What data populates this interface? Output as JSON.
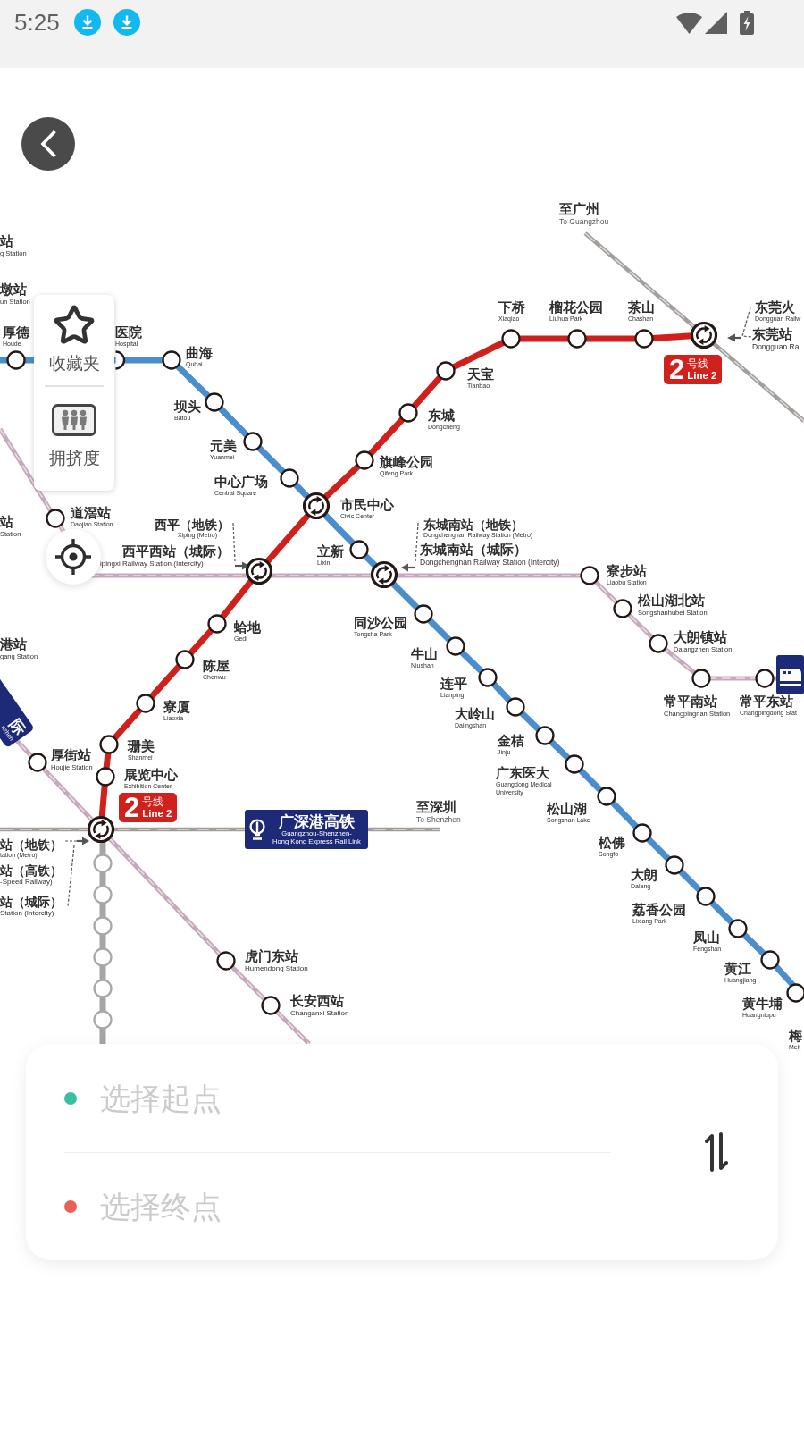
{
  "status_bar": {
    "time": "5:25"
  },
  "map": {
    "lines": [
      {
        "kind": "metro",
        "color": "#d0201b"
      },
      {
        "kind": "metro",
        "color": "#4a8ecd"
      },
      {
        "kind": "intercity",
        "color": "#c6a8bc"
      },
      {
        "kind": "intercity",
        "color": "#c6a8bc"
      },
      {
        "kind": "railway",
        "color": "#a29e9c"
      },
      {
        "kind": "railway",
        "color": "#a29e9c"
      },
      {
        "kind": "metro",
        "color": "#a5a5a5"
      }
    ],
    "stations": [
      {
        "kind": "interchange"
      },
      {
        "kind": "stop"
      },
      {
        "kind": "stop"
      },
      {
        "kind": "stop"
      },
      {
        "kind": "stop"
      },
      {
        "kind": "stop"
      },
      {
        "kind": "stop"
      },
      {
        "kind": "stop"
      },
      {
        "kind": "stop"
      },
      {
        "kind": "stop"
      },
      {
        "kind": "stop"
      },
      {
        "kind": "stop"
      },
      {
        "kind": "stop"
      },
      {
        "kind": "interchange"
      },
      {
        "kind": "stop"
      },
      {
        "kind": "stop"
      },
      {
        "kind": "interchange"
      },
      {
        "kind": "interchange"
      },
      {
        "kind": "stop"
      },
      {
        "kind": "stop"
      },
      {
        "kind": "stop"
      },
      {
        "kind": "stop"
      },
      {
        "kind": "stop"
      },
      {
        "kind": "stop"
      },
      {
        "kind": "stop"
      },
      {
        "kind": "stop"
      },
      {
        "kind": "stop"
      },
      {
        "kind": "stop"
      },
      {
        "kind": "stop"
      },
      {
        "kind": "stop"
      },
      {
        "kind": "stop"
      },
      {
        "kind": "stop"
      },
      {
        "kind": "stop"
      },
      {
        "kind": "stop"
      },
      {
        "kind": "stop"
      },
      {
        "kind": "stop"
      },
      {
        "kind": "interchange"
      },
      {
        "kind": "stop"
      },
      {
        "kind": "muted"
      },
      {
        "kind": "stop"
      },
      {
        "kind": "muted"
      },
      {
        "kind": "stop"
      },
      {
        "kind": "muted"
      },
      {
        "kind": "stop"
      },
      {
        "kind": "muted"
      },
      {
        "kind": "stop"
      },
      {
        "kind": "stop"
      },
      {
        "kind": "muted"
      },
      {
        "kind": "stop"
      },
      {
        "kind": "stop"
      },
      {
        "kind": "muted"
      }
    ],
    "labels": [
      {
        "kind": "station",
        "name": "站",
        "english": "g Station"
      },
      {
        "kind": "direction",
        "name": "至广州",
        "english": "To Guangzhou"
      },
      {
        "kind": "station",
        "name": "墩站",
        "english": "un Station"
      },
      {
        "kind": "station",
        "name": "下桥",
        "english": "Xiaqiao"
      },
      {
        "kind": "station",
        "name": "榴花公园",
        "english": "Liuhua Park"
      },
      {
        "kind": "station",
        "name": "茶山",
        "english": "Chashan"
      },
      {
        "kind": "station",
        "name": "东莞火",
        "english": "Dongguan Railw"
      },
      {
        "kind": "station",
        "name": "厚德",
        "english": "Houde"
      },
      {
        "kind": "station",
        "name": "医院",
        "english": "Hospital"
      },
      {
        "kind": "station",
        "name": "东莞站",
        "english": "Dongguan Ra"
      },
      {
        "kind": "station",
        "name": "曲海",
        "english": "Quhai"
      },
      {
        "kind": "station",
        "name": "天宝",
        "english": "Tianbao"
      },
      {
        "kind": "station",
        "name": "坝头",
        "english": "Batou"
      },
      {
        "kind": "station",
        "name": "东城",
        "english": "Dongcheng"
      },
      {
        "kind": "station",
        "name": "元美",
        "english": "Yuanmei"
      },
      {
        "kind": "station",
        "name": "旗峰公园",
        "english": "Qifeng Park"
      },
      {
        "kind": "station",
        "name": "中心广场",
        "english": "Central Square"
      },
      {
        "kind": "station",
        "name": "市民中心",
        "english": "Civic Center"
      },
      {
        "kind": "station",
        "name": "道滘站",
        "english": "Daojiao Station"
      },
      {
        "kind": "station",
        "name": "站",
        "english": "Station"
      },
      {
        "kind": "station",
        "name": "西平（地铁）",
        "english": "Xiping (Metro)"
      },
      {
        "kind": "station",
        "name": "东城南站（地铁）",
        "english": "Dongchengnan Railway Station (Metro)"
      },
      {
        "kind": "station",
        "name": "西平西站（城际）",
        "english": "ipingxi Railway Station (Intercity)"
      },
      {
        "kind": "station",
        "name": "立新",
        "english": "Lixin"
      },
      {
        "kind": "station",
        "name": "东城南站（城际）",
        "english": "Dongchengnan Railway Station (Intercity)"
      },
      {
        "kind": "station",
        "name": "寮步站",
        "english": "Liaobu Station"
      },
      {
        "kind": "station",
        "name": "松山湖北站",
        "english": "Songshanhubei Station"
      },
      {
        "kind": "station",
        "name": "蛤地",
        "english": "Gedi"
      },
      {
        "kind": "station",
        "name": "同沙公园",
        "english": "Tongsha Park"
      },
      {
        "kind": "station",
        "name": "大朗镇站",
        "english": "Dalangzhen Station"
      },
      {
        "kind": "station",
        "name": "港站",
        "english": "gang Station"
      },
      {
        "kind": "station",
        "name": "牛山",
        "english": "Niushan"
      },
      {
        "kind": "station",
        "name": "陈屋",
        "english": "Chenwu"
      },
      {
        "kind": "station",
        "name": "连平",
        "english": "Lianping"
      },
      {
        "kind": "station",
        "name": "寮厦",
        "english": "Liaoxia"
      },
      {
        "kind": "station",
        "name": "常平南站",
        "english": "Changpingnan Station"
      },
      {
        "kind": "station",
        "name": "常平东站",
        "english": "Changpingdong Stat"
      },
      {
        "kind": "station",
        "name": "大岭山",
        "english": "Dalingshan"
      },
      {
        "kind": "station",
        "name": "珊美",
        "english": "Shanmei"
      },
      {
        "kind": "station",
        "name": "金桔",
        "english": "Jinju"
      },
      {
        "kind": "station",
        "name": "厚街站",
        "english": "Houjie Station"
      },
      {
        "kind": "station",
        "name": "展览中心",
        "english": "Exhibition Center"
      },
      {
        "kind": "station",
        "name": "广东医大",
        "english": "Guangdong Medical University"
      },
      {
        "kind": "direction",
        "name": "至深圳",
        "english": "To Shenzhen"
      },
      {
        "kind": "station",
        "name": "松山湖",
        "english": "Songshan Lake"
      },
      {
        "kind": "station",
        "name": "站（地铁）",
        "english": "tation (Metro)"
      },
      {
        "kind": "station",
        "name": "松佛",
        "english": "Songfo"
      },
      {
        "kind": "station",
        "name": "站（高铁）",
        "english": "-Speed Railway)"
      },
      {
        "kind": "station",
        "name": "大朗",
        "english": "Dalang"
      },
      {
        "kind": "station",
        "name": "站（城际）",
        "english": "Station (Intercity)"
      },
      {
        "kind": "station",
        "name": "荔香公园",
        "english": "Lixiang Park"
      },
      {
        "kind": "station",
        "name": "凤山",
        "english": "Fengshan"
      },
      {
        "kind": "station",
        "name": "虎门东站",
        "english": "Humendong Station"
      },
      {
        "kind": "station",
        "name": "黄江",
        "english": "Huangjiang"
      },
      {
        "kind": "station",
        "name": "长安西站",
        "english": "Changanxi Station"
      },
      {
        "kind": "station",
        "name": "黄牛埔",
        "english": "Huangniupu"
      },
      {
        "kind": "station",
        "name": "梅",
        "english": "Meit"
      }
    ],
    "line_badges": [
      {
        "number": "2",
        "chinese": "号线",
        "english": "Line 2"
      },
      {
        "number": "2",
        "chinese": "号线",
        "english": "Line 2"
      }
    ],
    "rail_badges": [
      {
        "kind": "express",
        "name": "广深港高铁",
        "english": [
          "Guangzhou-Shenzhen-",
          "Hong Kong Express Rail Link"
        ]
      },
      {
        "kind": "tilted",
        "name": "际",
        "english": [
          "nzhen"
        ]
      }
    ]
  },
  "side_menu": [
    {
      "kind": "favorites",
      "label": "收藏夹"
    },
    {
      "kind": "crowding",
      "label": "拥挤度"
    }
  ],
  "route_panel": {
    "endpoints": [
      {
        "placeholder": "选择起点",
        "color": "#3dbda1"
      },
      {
        "placeholder": "选择终点",
        "color": "#ea5f57"
      }
    ]
  }
}
